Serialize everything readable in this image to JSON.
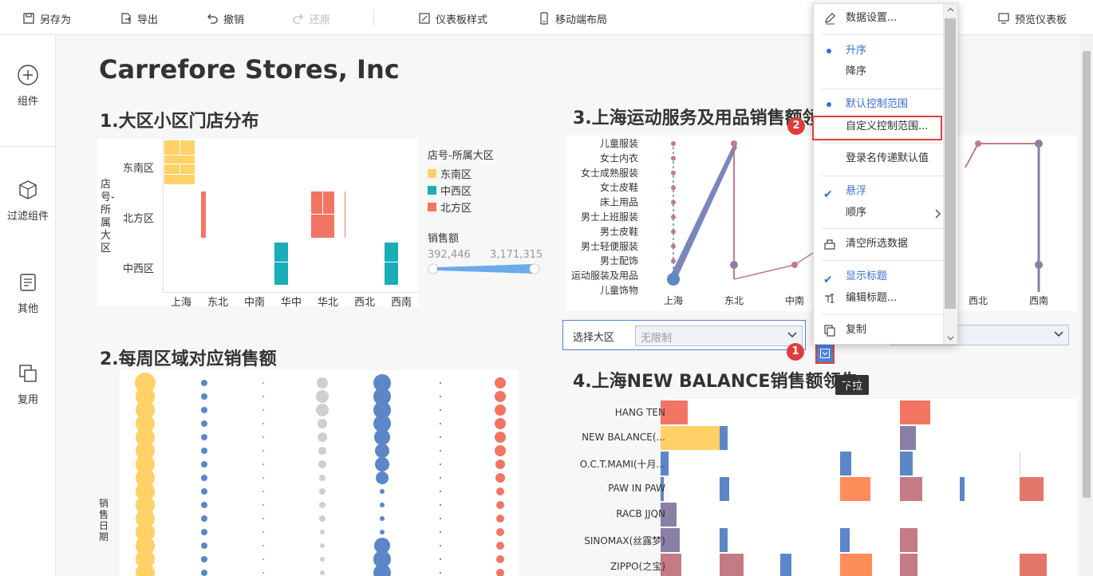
{
  "toolbar": {
    "save_as": "另存为",
    "export": "导出",
    "undo": "撤销",
    "redo": "还原",
    "dashboard_style": "仪表板样式",
    "mobile_layout": "移动端布局",
    "preview": "预览仪表板"
  },
  "sidebar": {
    "items": [
      {
        "label": "组件",
        "icon": "plus-circle-icon"
      },
      {
        "label": "过滤组件",
        "icon": "cube-icon"
      },
      {
        "label": "其他",
        "icon": "document-icon"
      },
      {
        "label": "复用",
        "icon": "copy-icon"
      }
    ]
  },
  "dashboard": {
    "title": "Carrefore Stores, Inc"
  },
  "chart1": {
    "title": "1.大区小区门店分布",
    "y_axis_title": "店号-所属大区",
    "y_categories": [
      "东南区",
      "北方区",
      "中西区"
    ],
    "x_categories": [
      "上海",
      "东北",
      "中南",
      "华中",
      "华北",
      "西北",
      "西南"
    ],
    "legend_title": "店号-所属大区",
    "legend": [
      {
        "name": "东南区",
        "color": "#ffd166"
      },
      {
        "name": "中西区",
        "color": "#1aaeb8"
      },
      {
        "name": "北方区",
        "color": "#f27564"
      }
    ],
    "size_legend_title": "销售额",
    "size_min": "392,446",
    "size_max": "3,171,315"
  },
  "chart2": {
    "title": "2.每周区域对应销售额",
    "y_axis_title": "销售日期"
  },
  "chart3": {
    "title": "3.上海运动服务及用品销售额领",
    "y_categories": [
      "儿童服装",
      "女士内衣",
      "女士成熟服装",
      "女士皮鞋",
      "床上用品",
      "男士上班服装",
      "男士皮鞋",
      "男士轻便服装",
      "男士配饰",
      "运动服装及用品",
      "儿童饰物"
    ],
    "x_categories": [
      "上海",
      "东北",
      "中南",
      "西北",
      "西南"
    ]
  },
  "filter": {
    "label": "选择大区",
    "value": "无限制"
  },
  "tooltip": "下拉",
  "chart4": {
    "title": "4.上海NEW BALANCE销售额领先",
    "brands": [
      "HANG TEN",
      "NEW BALANCE(...",
      "O.C.T.MAMI(十月...",
      "PAW IN PAW",
      "RACB JJQN",
      "SINOMAX(丝露梦)",
      "ZIPPO(之宝)"
    ]
  },
  "menu": {
    "data_settings": "数据设置...",
    "ascending": "升序",
    "descending": "降序",
    "default_range": "默认控制范围",
    "custom_range": "自定义控制范围...",
    "login_default": "登录名传递默认值",
    "floating": "悬浮",
    "order": "顺序",
    "clear_selected": "清空所选数据",
    "show_title": "显示标题",
    "edit_title": "编辑标题...",
    "copy": "复制"
  },
  "badges": {
    "one": "1",
    "two": "2"
  },
  "colors": {
    "accent": "#3a6fd8",
    "highlight": "#e03c3c",
    "yellow": "#ffd166",
    "teal": "#1aaeb8",
    "coral": "#f27564",
    "blue_dot": "#5b86c8",
    "gray_dot": "#cfcfcf",
    "mauve": "#c47b84",
    "purple": "#8a7fa6"
  }
}
